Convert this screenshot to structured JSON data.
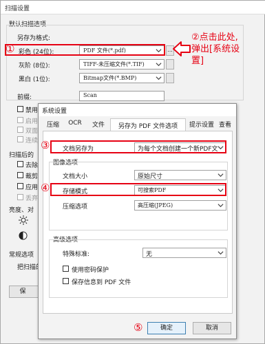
{
  "back": {
    "title": "扫描设置",
    "default_group": "默认扫描选项",
    "save_as_label": "另存为格式:",
    "color_label": "彩色 (24位):",
    "color_value": "PDF 文件(*.pdf)",
    "browse_label": "...",
    "gray_label": "灰阶 (8位):",
    "gray_value": "TIFF-未压缩文件(*.TIF)",
    "bw_label": "黑白 (1位):",
    "bw_value": "Bitmap文件(*.BMP)",
    "prefix_label": "前缀:",
    "prefix_value": "Scan",
    "chk1": "禁用",
    "chk2": "启用",
    "chk3": "双面",
    "chk4": "连续",
    "after_label": "扫描后的",
    "chk5": "去除",
    "chk6": "裁剪",
    "chk7": "应用",
    "chk8": "丢弃",
    "brightness_label": "亮度、对",
    "general_label": "常规选项",
    "scan_to_label": "把扫描的",
    "bottom_btn_label": "保"
  },
  "annotation": {
    "num1": "①",
    "num2": "②",
    "num3": "③",
    "num4": "④",
    "num5": "⑤",
    "callout_line1": "②点击此处,",
    "callout_line2": "弹出[系统设",
    "callout_line3": "置]"
  },
  "front": {
    "title": "系统设置",
    "tabs": [
      "压缩",
      "OCR",
      "文件",
      "另存为 PDF 文件选项",
      "提示设置",
      "查看"
    ],
    "save_doc_as_label": "文档另存为",
    "save_doc_as_value": "为每个文档创建一个新PDF文",
    "image_group": "图像选项",
    "doc_size_label": "文档大小",
    "doc_size_value": "原始尺寸",
    "storage_mode_label": "存储模式",
    "storage_mode_value": "可搜索PDF",
    "compression_label": "压缩选项",
    "compression_value": "高压缩(JPEG)",
    "advanced_group": "高级选项",
    "special_label": "特殊标准:",
    "special_value": "无",
    "password_label": "使用密码保护",
    "save_info_label": "保存信息到 PDF 文件",
    "ok_label": "确定",
    "cancel_label": "取消"
  },
  "colors": {
    "accent_red": "#e60012",
    "ok_border": "#3c7fb1"
  }
}
